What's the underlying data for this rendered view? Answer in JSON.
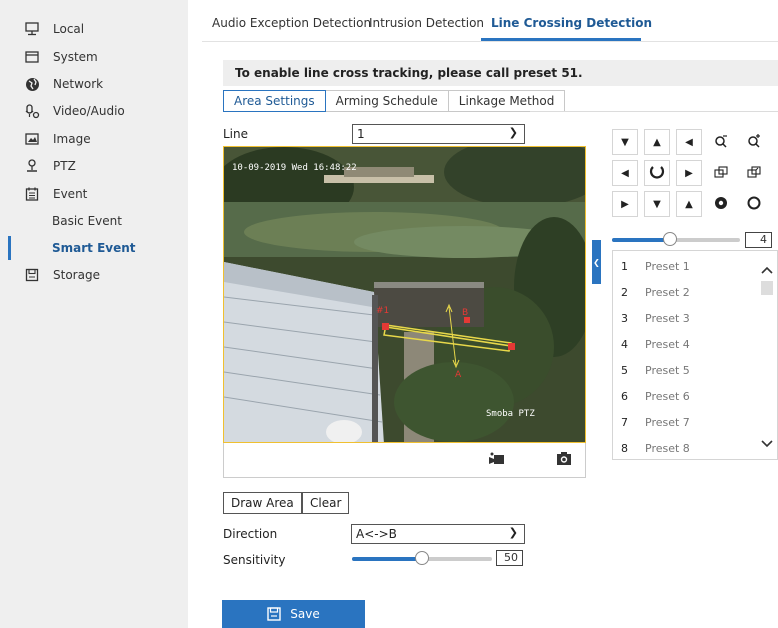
{
  "sidebar": {
    "items": [
      {
        "label": "Local",
        "icon": "monitor-icon"
      },
      {
        "label": "System",
        "icon": "window-icon"
      },
      {
        "label": "Network",
        "icon": "globe-icon"
      },
      {
        "label": "Video/Audio",
        "icon": "video-audio-icon"
      },
      {
        "label": "Image",
        "icon": "image-icon"
      },
      {
        "label": "PTZ",
        "icon": "ptz-icon"
      },
      {
        "label": "Event",
        "icon": "calendar-icon"
      },
      {
        "label": "Storage",
        "icon": "storage-icon"
      }
    ],
    "sub_items": [
      {
        "label": "Basic Event"
      },
      {
        "label": "Smart Event"
      }
    ],
    "active_sub": "Smart Event"
  },
  "tabs": [
    {
      "label": "Audio Exception Detection"
    },
    {
      "label": "Intrusion Detection"
    },
    {
      "label": "Line Crossing Detection"
    }
  ],
  "active_tab": "Line Crossing Detection",
  "notice": "To enable line cross tracking, please call preset 51.",
  "subtabs": [
    {
      "label": "Area Settings"
    },
    {
      "label": "Arming Schedule"
    },
    {
      "label": "Linkage Method"
    }
  ],
  "line": {
    "label": "Line",
    "value": "1"
  },
  "video": {
    "osd_time": "10-09-2019 Wed 16:48:22",
    "osd_name": "Smoba PTZ",
    "line_label_a": "A",
    "line_label_b": "B",
    "line_point_label": "#1"
  },
  "buttons": {
    "draw_area": "Draw Area",
    "clear": "Clear",
    "save": "Save"
  },
  "direction": {
    "label": "Direction",
    "value": "A<->B"
  },
  "sensitivity": {
    "label": "Sensitivity",
    "value": "50",
    "fraction": 0.5
  },
  "ptz": {
    "speed_value": "4",
    "speed_fraction": 0.45,
    "presets": [
      {
        "num": "1",
        "name": "Preset 1"
      },
      {
        "num": "2",
        "name": "Preset 2"
      },
      {
        "num": "3",
        "name": "Preset 3"
      },
      {
        "num": "4",
        "name": "Preset 4"
      },
      {
        "num": "5",
        "name": "Preset 5"
      },
      {
        "num": "6",
        "name": "Preset 6"
      },
      {
        "num": "7",
        "name": "Preset 7"
      },
      {
        "num": "8",
        "name": "Preset 8"
      }
    ]
  },
  "colors": {
    "accent": "#2a74c0",
    "video_border": "#f0c030",
    "rule_line": "#e53935",
    "sidebar_bg": "#efefef"
  }
}
